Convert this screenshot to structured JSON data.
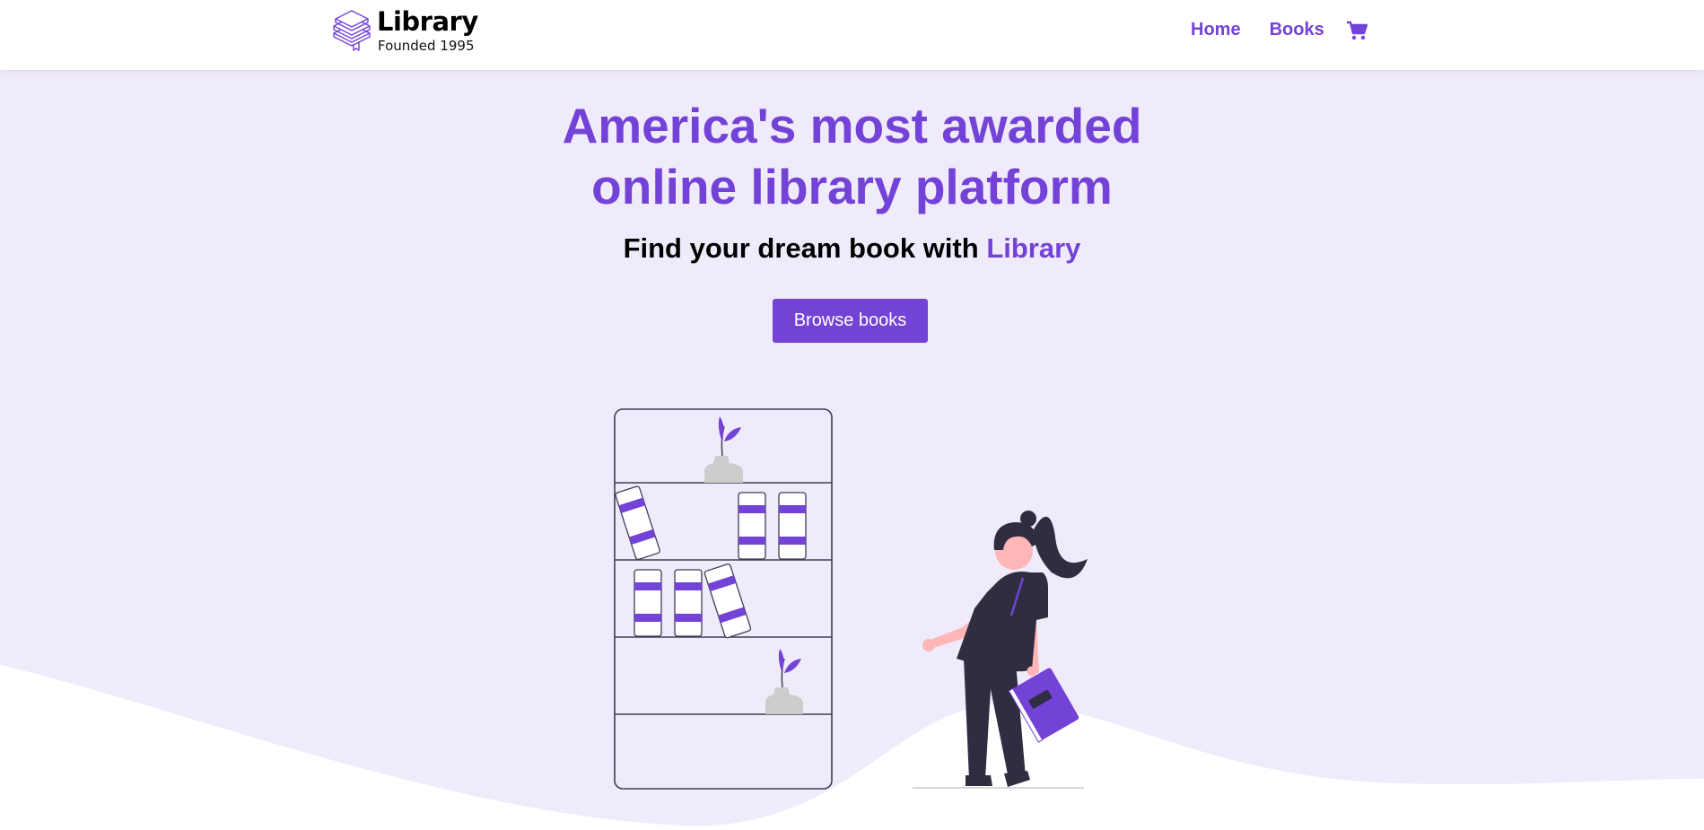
{
  "nav": {
    "logo_title": "Library",
    "logo_subtitle": "Founded 1995",
    "logo_icon": "book-stack-icon",
    "links": [
      {
        "label": "Home"
      },
      {
        "label": "Books"
      }
    ],
    "cart_icon": "shopping-cart-icon"
  },
  "hero": {
    "title_line1": "America's most awarded",
    "title_line2": "online library platform",
    "subtitle_prefix": "Find your dream book with ",
    "subtitle_brand": "Library",
    "cta_label": "Browse books"
  },
  "colors": {
    "accent": "#7342d6",
    "hero_background": "#f0ebfa",
    "text": "#000000",
    "figure_dark": "#2f2e41",
    "skin": "#ffb6b6",
    "pot": "#cccccc"
  }
}
